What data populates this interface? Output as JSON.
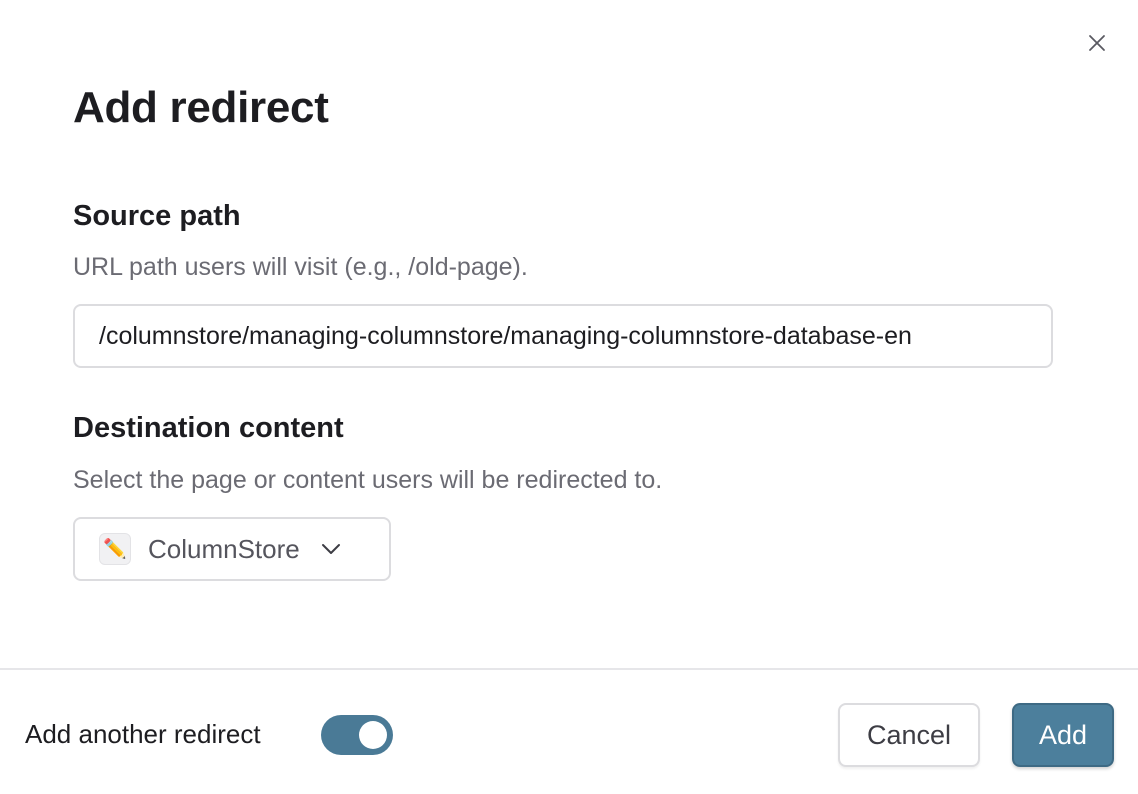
{
  "dialog": {
    "title": "Add redirect",
    "close_icon": "close-icon"
  },
  "source": {
    "label": "Source path",
    "description": "URL path users will visit (e.g., /old-page).",
    "value": "/columnstore/managing-columnstore/managing-columnstore-database-en"
  },
  "destination": {
    "label": "Destination content",
    "description": "Select the page or content users will be redirected to.",
    "selected_icon": "pencil-emoji-icon",
    "selected_emoji": "✏️",
    "selected_label": "ColumnStore",
    "chevron_icon": "chevron-down-icon"
  },
  "footer": {
    "add_another_label": "Add another redirect",
    "add_another_enabled": true,
    "cancel_label": "Cancel",
    "add_label": "Add"
  },
  "colors": {
    "accent": "#4c7f9c",
    "toggle_on": "#4a7a96",
    "text_primary": "#1d1d21",
    "text_secondary": "#6b6b73",
    "border": "#dcdcdf"
  }
}
